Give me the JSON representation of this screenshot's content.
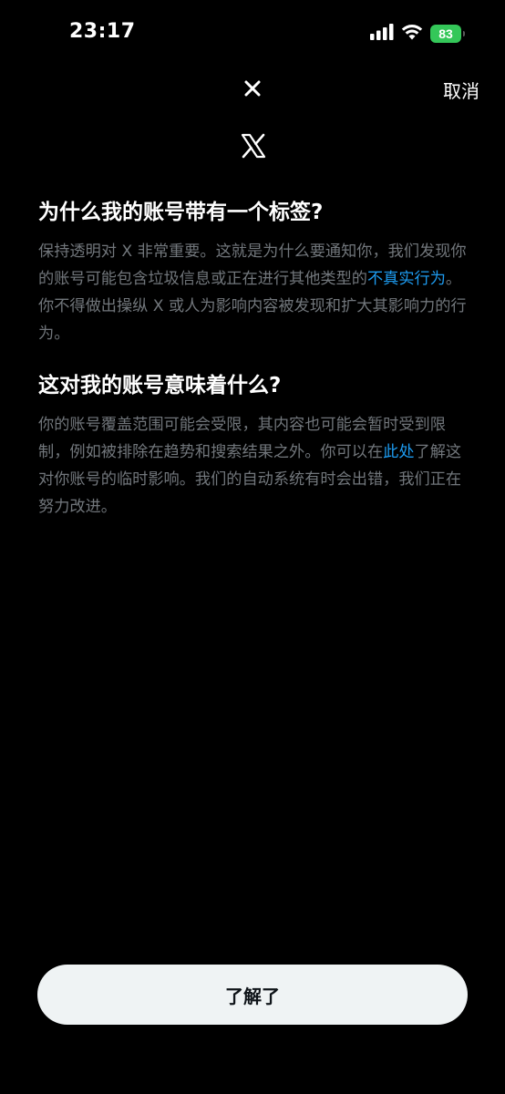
{
  "status_bar": {
    "time": "23:17",
    "battery_level": "83",
    "battery_color": "#34c759",
    "icons": [
      "cellular-signal-icon",
      "wifi-icon",
      "battery-icon"
    ]
  },
  "header": {
    "close_icon": "x-close-icon",
    "cancel_label": "取消",
    "logo_icon": "x-logo-icon"
  },
  "section1": {
    "title": "为什么我的账号带有一个标签?",
    "body_part1": "保持透明对 X 非常重要。这就是为什么要通知你，我们发现你的账号可能包含垃圾信息或正在进行其他类型的",
    "link": "不真实行为",
    "body_part2": "。你不得做出操纵 X 或人为影响内容被发现和扩大其影响力的行为。"
  },
  "section2": {
    "title": "这对我的账号意味着什么?",
    "body_part1": "你的账号覆盖范围可能会受限，其内容也可能会暂时受到限制，例如被排除在趋势和搜索结果之外。你可以在",
    "link": "此处",
    "body_part2": "了解这对你账号的临时影响。我们的自动系统有时会出错，我们正在努力改进。"
  },
  "footer": {
    "button_label": "了解了"
  },
  "colors": {
    "background": "#000000",
    "link": "#1d9bf0",
    "body_text": "#71767b",
    "button_bg": "#eff3f4"
  }
}
